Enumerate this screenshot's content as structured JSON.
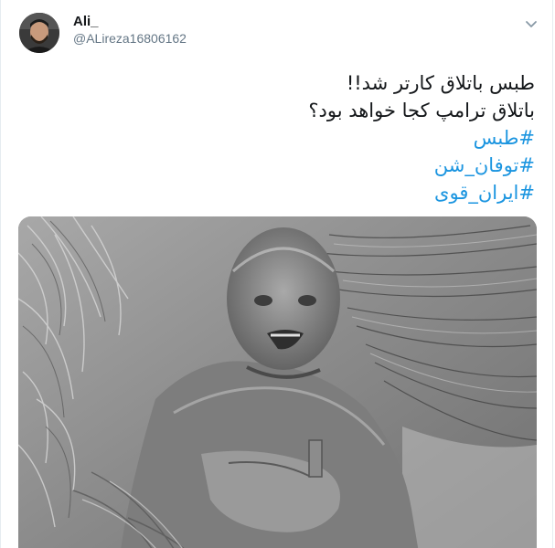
{
  "tweet": {
    "author": {
      "display_name": "Ali_",
      "handle": "@ALireza16806162",
      "avatar_icon": "avatar-photo"
    },
    "menu_icon": "chevron-down-icon",
    "text_lines": [
      "طبس باتلاق کارتر شد!!",
      "باتلاق  ترامپ کجا خواهد بود؟"
    ],
    "hashtags": [
      "#طبس",
      "#توفان_شن",
      "#ایران_قوی"
    ],
    "media": {
      "type": "photo",
      "tone": "grayscale"
    }
  },
  "colors": {
    "link": "#1b95e0",
    "text": "#14171a",
    "secondary": "#657786",
    "border": "#e6ecf0"
  }
}
